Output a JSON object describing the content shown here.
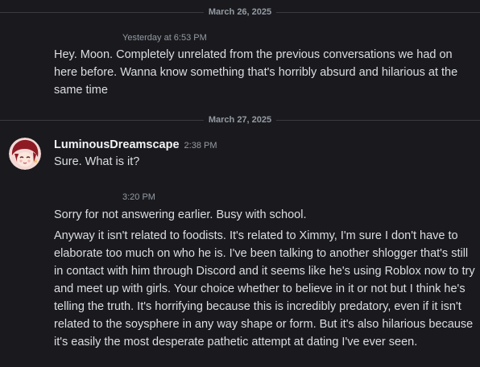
{
  "dividers": {
    "first": "March 26, 2025",
    "second": "March 27, 2025"
  },
  "messages": [
    {
      "timestamp": "Yesterday at 6:53 PM",
      "text": "Hey. Moon. Completely unrelated from the previous conversations we had on here before. Wanna know something that's horribly absurd and hilarious at the same time"
    },
    {
      "author": "LuminousDreamscape",
      "timestamp": "2:38 PM",
      "text": "Sure.  What is it?"
    },
    {
      "timestamp": "3:20 PM",
      "text": "Sorry for not answering earlier. Busy with school."
    },
    {
      "text": "Anyway it isn't related to foodists. It's related to Ximmy, I'm sure I don't have to elaborate too much on who he is. I've been talking to another shlogger that's still in contact with him through Discord and it seems like he's using Roblox now to try and meet up with girls. Your choice whether to believe in it or not but I think he's telling the truth. It's horrifying because this is incredibly predatory, even if it isn't related to the soysphere in any way shape or form. But it's also hilarious because it's easily the most desperate pathetic attempt at dating I've ever seen."
    }
  ],
  "colors": {
    "background": "#1a1a1e",
    "text": "#dbdee1",
    "muted": "#949ba4",
    "author": "#f2f3f5"
  }
}
